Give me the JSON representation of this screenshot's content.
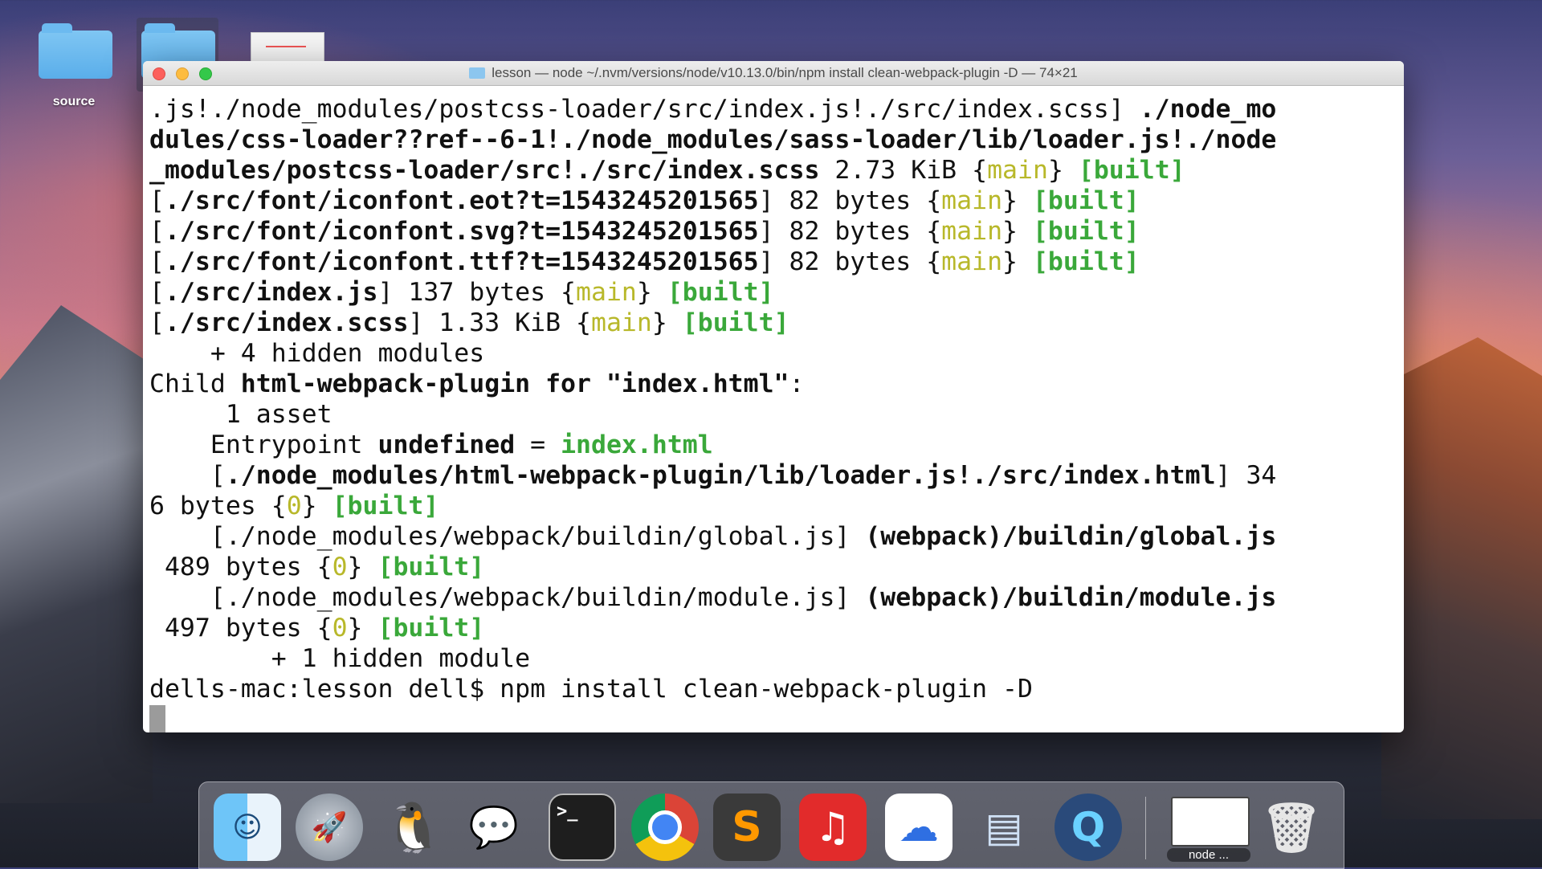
{
  "desktop": {
    "items": [
      {
        "label": "source",
        "icon": "folder-icon"
      },
      {
        "label": "",
        "icon": "folder-icon"
      },
      {
        "label": "",
        "icon": "document-thumbnail-icon"
      }
    ]
  },
  "terminal": {
    "title": "lesson — node ~/.nvm/versions/node/v10.13.0/bin/npm install clean-webpack-plugin -D — 74×21",
    "lines": [
      [
        {
          "t": ".js!./node_modules/postcss-loader/src/index.js!./src/index.scss] "
        },
        {
          "t": "./node_mo",
          "c": "b"
        }
      ],
      [
        {
          "t": "dules/css-loader??ref--6-1!./node_modules/sass-loader/lib/loader.js!./node",
          "c": "b"
        }
      ],
      [
        {
          "t": "_modules/postcss-loader/src!./src/index.scss",
          "c": "b"
        },
        {
          "t": " 2.73 KiB {"
        },
        {
          "t": "main",
          "c": "yellow"
        },
        {
          "t": "} "
        },
        {
          "t": "[built]",
          "c": "green"
        }
      ],
      [
        {
          "t": "["
        },
        {
          "t": "./src/font/iconfont.eot?t=1543245201565",
          "c": "b"
        },
        {
          "t": "] 82 bytes {"
        },
        {
          "t": "main",
          "c": "yellow"
        },
        {
          "t": "} "
        },
        {
          "t": "[built]",
          "c": "green"
        }
      ],
      [
        {
          "t": "["
        },
        {
          "t": "./src/font/iconfont.svg?t=1543245201565",
          "c": "b"
        },
        {
          "t": "] 82 bytes {"
        },
        {
          "t": "main",
          "c": "yellow"
        },
        {
          "t": "} "
        },
        {
          "t": "[built]",
          "c": "green"
        }
      ],
      [
        {
          "t": "["
        },
        {
          "t": "./src/font/iconfont.ttf?t=1543245201565",
          "c": "b"
        },
        {
          "t": "] 82 bytes {"
        },
        {
          "t": "main",
          "c": "yellow"
        },
        {
          "t": "} "
        },
        {
          "t": "[built]",
          "c": "green"
        }
      ],
      [
        {
          "t": "["
        },
        {
          "t": "./src/index.js",
          "c": "b"
        },
        {
          "t": "] 137 bytes {"
        },
        {
          "t": "main",
          "c": "yellow"
        },
        {
          "t": "} "
        },
        {
          "t": "[built]",
          "c": "green"
        }
      ],
      [
        {
          "t": "["
        },
        {
          "t": "./src/index.scss",
          "c": "b"
        },
        {
          "t": "] 1.33 KiB {"
        },
        {
          "t": "main",
          "c": "yellow"
        },
        {
          "t": "} "
        },
        {
          "t": "[built]",
          "c": "green"
        }
      ],
      [
        {
          "t": "    + 4 hidden modules"
        }
      ],
      [
        {
          "t": "Child "
        },
        {
          "t": "html-webpack-plugin for \"index.html\"",
          "c": "b"
        },
        {
          "t": ":"
        }
      ],
      [
        {
          "t": "     1 asset"
        }
      ],
      [
        {
          "t": "    Entrypoint "
        },
        {
          "t": "undefined",
          "c": "b"
        },
        {
          "t": " = "
        },
        {
          "t": "index.html",
          "c": "green"
        }
      ],
      [
        {
          "t": "    ["
        },
        {
          "t": "./node_modules/html-webpack-plugin/lib/loader.js!./src/index.html",
          "c": "b"
        },
        {
          "t": "] 34"
        }
      ],
      [
        {
          "t": "6 bytes {"
        },
        {
          "t": "0",
          "c": "yellow"
        },
        {
          "t": "} "
        },
        {
          "t": "[built]",
          "c": "green"
        }
      ],
      [
        {
          "t": "    [./node_modules/webpack/buildin/global.js] "
        },
        {
          "t": "(webpack)/buildin/global.js",
          "c": "b"
        }
      ],
      [
        {
          "t": " 489 bytes {"
        },
        {
          "t": "0",
          "c": "yellow"
        },
        {
          "t": "} "
        },
        {
          "t": "[built]",
          "c": "green"
        }
      ],
      [
        {
          "t": "    [./node_modules/webpack/buildin/module.js] "
        },
        {
          "t": "(webpack)/buildin/module.js",
          "c": "b"
        }
      ],
      [
        {
          "t": " 497 bytes {"
        },
        {
          "t": "0",
          "c": "yellow"
        },
        {
          "t": "} "
        },
        {
          "t": "[built]",
          "c": "green"
        }
      ],
      [
        {
          "t": "        + 1 hidden module"
        }
      ],
      [
        {
          "t": "dells-mac:lesson dell$ npm install clean-webpack-plugin -D"
        }
      ]
    ]
  },
  "dock": {
    "apps": [
      {
        "name": "Finder",
        "icon": "finder-icon",
        "glyph": "☺"
      },
      {
        "name": "Launchpad",
        "icon": "launchpad-icon",
        "glyph": "🚀"
      },
      {
        "name": "QQ",
        "icon": "qq-icon",
        "glyph": "🐧"
      },
      {
        "name": "WeChat",
        "icon": "wechat-icon",
        "glyph": "💬"
      },
      {
        "name": "Terminal",
        "icon": "terminal-icon",
        "glyph": ">_"
      },
      {
        "name": "Chrome",
        "icon": "chrome-icon",
        "glyph": ""
      },
      {
        "name": "Sublime Text",
        "icon": "sublime-icon",
        "glyph": "S"
      },
      {
        "name": "NetEase Music",
        "icon": "netease-music-icon",
        "glyph": "♫"
      },
      {
        "name": "Baidu Netdisk",
        "icon": "baidu-netdisk-icon",
        "glyph": "☁"
      },
      {
        "name": "Keynote",
        "icon": "keynote-icon",
        "glyph": "▤"
      },
      {
        "name": "QuickTime",
        "icon": "quicktime-icon",
        "glyph": "Q"
      },
      {
        "name": "Trash",
        "icon": "trash-icon",
        "glyph": "🗑"
      }
    ],
    "minimized_window_label": "node ..."
  },
  "colors": {
    "yellow_token": "#b8b82a",
    "green_token": "#3aa83a",
    "close": "#fc605c",
    "minimize": "#fdbc40",
    "maximize": "#34c84a"
  }
}
